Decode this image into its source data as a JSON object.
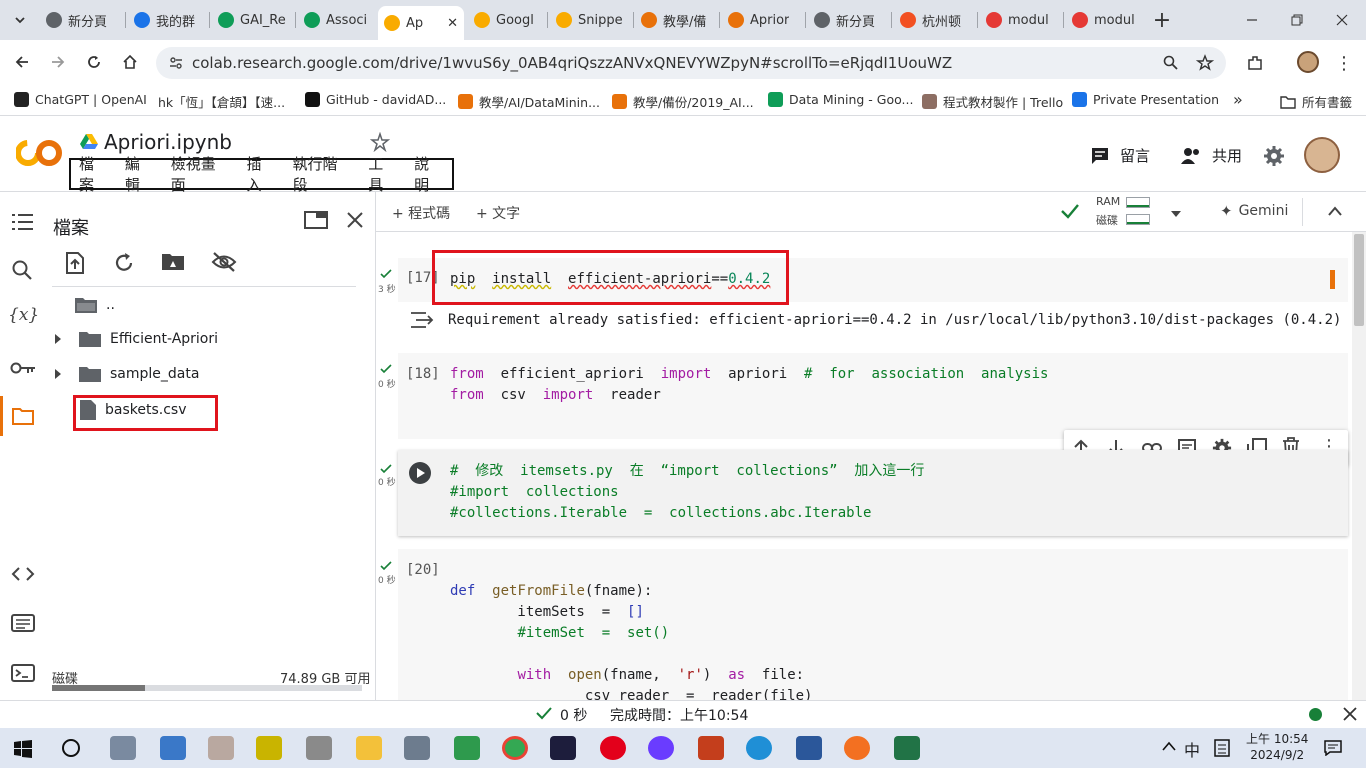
{
  "browser": {
    "tabs": [
      {
        "label": "新分頁",
        "color": "#5f6368"
      },
      {
        "label": "我的群",
        "color": "#1a73e8"
      },
      {
        "label": "GAI_Re",
        "color": "#0f9d58"
      },
      {
        "label": "Associ",
        "color": "#0f9d58"
      },
      {
        "label": "Ap",
        "color": "#f9ab00",
        "active": true
      },
      {
        "label": "Googl",
        "color": "#f9ab00"
      },
      {
        "label": "Snippe",
        "color": "#f9ab00"
      },
      {
        "label": "教學/備",
        "color": "#e8710a"
      },
      {
        "label": "Aprior",
        "color": "#e8710a"
      },
      {
        "label": "新分頁",
        "color": "#5f6368"
      },
      {
        "label": "杭州顿",
        "color": "#f25022"
      },
      {
        "label": "modul",
        "color": "#e53935"
      },
      {
        "label": "modul",
        "color": "#e53935"
      }
    ],
    "url": "colab.research.google.com/drive/1wvuS6y_0AB4qriQszzANVxQNEVYWZpyN#scrollTo=eRjqdI1UouWZ",
    "bookmarks": [
      "ChatGPT | OpenAI",
      "hk「恆」【倉頡】【速...",
      "GitHub - davidAD...",
      "教學/AI/DataMinin...",
      "教學/備份/2019_AI...",
      "Data Mining - Goo...",
      "程式教材製作 | Trello",
      "Private Presentation"
    ],
    "all_bookmarks": "所有書籤"
  },
  "colab": {
    "notebook_title": "Apriori.ipynb",
    "menu": [
      "檔案",
      "編輯",
      "檢視畫面",
      "插入",
      "執行階段",
      "工具",
      "說明"
    ],
    "comment_label": "留言",
    "share_label": "共用",
    "toolbar": {
      "add_code": "+ 程式碼",
      "add_text": "+ 文字",
      "ram_label": "RAM",
      "disk_label": "磁碟",
      "gemini_label": "Gemini"
    }
  },
  "files_panel": {
    "title": "檔案",
    "items": [
      {
        "name": "..",
        "type": "folder-up"
      },
      {
        "name": "Efficient-Apriori",
        "type": "folder"
      },
      {
        "name": "sample_data",
        "type": "folder"
      },
      {
        "name": "baskets.csv",
        "type": "file"
      }
    ],
    "disk_label": "磁碟",
    "disk_free": "74.89 GB 可用",
    "disk_usage_fraction": 0.3
  },
  "cells": {
    "c17": {
      "prompt": "[17]",
      "time": "3 秒",
      "code": "pip install efficient-apriori==0.4.2",
      "output": "Requirement already satisfied: efficient-apriori==0.4.2 in /usr/local/lib/python3.10/dist-packages (0.4.2)"
    },
    "c18": {
      "prompt": "[18]",
      "time": "0 秒"
    },
    "c19": {
      "time": "0 秒"
    },
    "c20": {
      "prompt": "[20]",
      "time": "0 秒"
    }
  },
  "status_bar": {
    "time": "0 秒",
    "completed": "完成時間：上午10:54"
  },
  "taskbar": {
    "ime": "中",
    "time": "上午 10:54",
    "date": "2024/9/2"
  }
}
